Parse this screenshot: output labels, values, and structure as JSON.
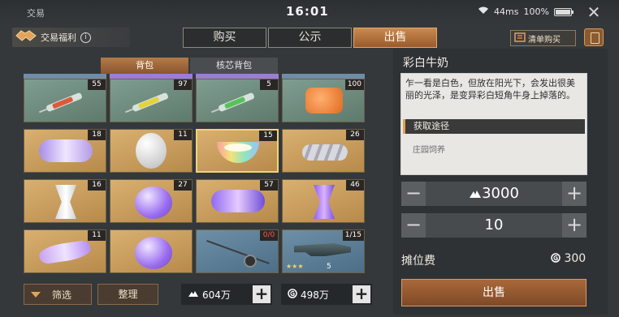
{
  "status": {
    "app_name": "交易",
    "time": "16:01",
    "network": "44ms",
    "battery": "100%"
  },
  "header": {
    "welfare_label": "交易福利",
    "tabs": [
      {
        "label": "购买",
        "active": false
      },
      {
        "label": "公示",
        "active": false
      },
      {
        "label": "出售",
        "active": true
      }
    ],
    "list_buy_label": "清单购买"
  },
  "bag_tabs": [
    {
      "label": "背包",
      "active": true
    },
    {
      "label": "核芯背包",
      "active": false
    }
  ],
  "grid": {
    "rows": [
      [
        {
          "item": "red-serum-syringe",
          "qty": "55",
          "bg": "green"
        },
        {
          "item": "yellow-serum-syringe",
          "qty": "97",
          "bg": "green"
        },
        {
          "item": "green-serum-syringe",
          "qty": "5",
          "bg": "green"
        },
        {
          "item": "orange-jelly",
          "qty": "100",
          "bg": "green"
        }
      ],
      [
        {
          "item": "cloud-cotton",
          "qty": "18",
          "bg": "gold"
        },
        {
          "item": "white-egg",
          "qty": "11",
          "bg": "gold"
        },
        {
          "item": "rainbow-milk-bowl",
          "qty": "15",
          "bg": "gold",
          "selected": true
        },
        {
          "item": "silver-rope",
          "qty": "26",
          "bg": "gold"
        }
      ],
      [
        {
          "item": "white-spool",
          "qty": "16",
          "bg": "gold"
        },
        {
          "item": "purple-blob",
          "qty": "27",
          "bg": "gold"
        },
        {
          "item": "nebula-cloud",
          "qty": "57",
          "bg": "gold"
        },
        {
          "item": "purple-spool",
          "qty": "46",
          "bg": "gold"
        }
      ],
      [
        {
          "item": "purple-feather",
          "qty": "11",
          "bg": "gold"
        },
        {
          "item": "purple-blob",
          "qty": "",
          "bg": "gold"
        },
        {
          "item": "fishing-rod",
          "qty": "0/0",
          "bg": "blue",
          "qty_red": true
        },
        {
          "item": "rifle",
          "qty": "1/15",
          "bg": "blue",
          "stars": "★★★",
          "level": "5"
        }
      ]
    ]
  },
  "bottom": {
    "filter_label": "筛选",
    "sort_label": "整理",
    "currency_a": "604万",
    "currency_b": "498万"
  },
  "detail": {
    "name": "彩白牛奶",
    "description": "乍一看是白色，但放在阳光下，会发出很美丽的光泽，是变异彩白短角牛身上掉落的。",
    "source_header": "获取途径",
    "source_text": "庄园饲养",
    "price": "3000",
    "quantity": "10",
    "stall_fee_label": "摊位费",
    "stall_fee_value": "300",
    "sell_label": "出售"
  }
}
